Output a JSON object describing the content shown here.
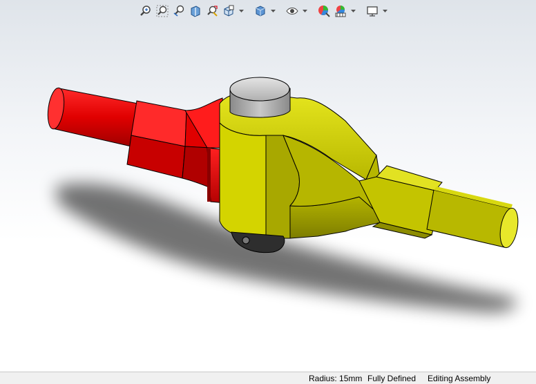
{
  "heads_up_toolbar": {
    "buttons": [
      {
        "icon": "zoom-to-fit-icon"
      },
      {
        "icon": "zoom-to-area-icon"
      },
      {
        "icon": "previous-view-icon"
      },
      {
        "icon": "section-view-icon"
      },
      {
        "icon": "dynamic-annotation-views-icon"
      },
      {
        "icon": "view-orientation-icon"
      },
      {
        "icon": "display-style-icon"
      },
      {
        "icon": "hide-show-items-icon"
      },
      {
        "icon": "edit-appearance-icon"
      },
      {
        "icon": "apply-scene-icon"
      },
      {
        "icon": "view-settings-icon"
      }
    ]
  },
  "model": {
    "left_component_color": "#e00000",
    "right_component_color": "#c8c800",
    "pin_color": "#c0c0c0"
  },
  "status_bar": {
    "measurement": "Radius: 15mm",
    "sketch_state": "Fully Defined",
    "mode": "Editing Assembly"
  }
}
